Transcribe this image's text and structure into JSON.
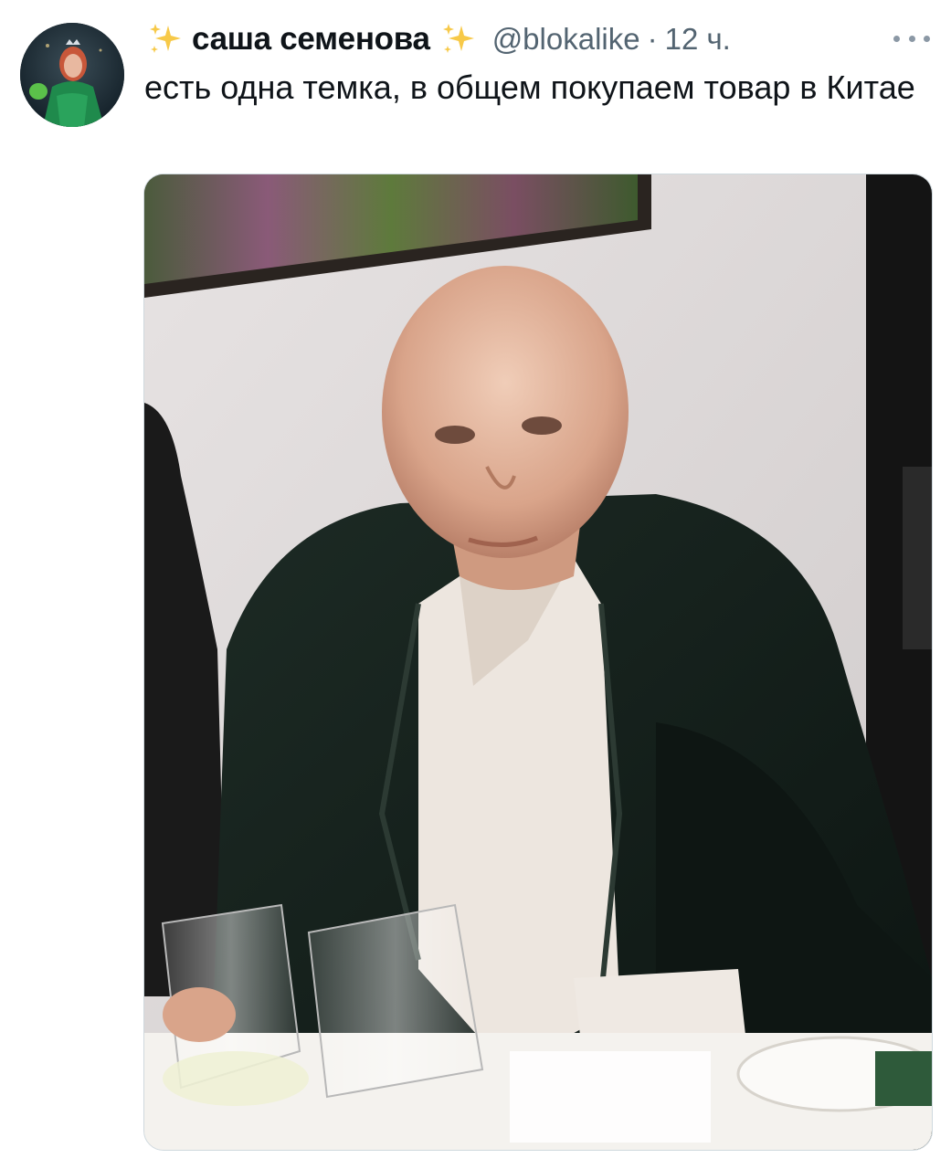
{
  "tweet": {
    "author": {
      "display_name": "саша семенова",
      "handle": "@blokalike",
      "avatar_icon": "avatar-image"
    },
    "separator": "·",
    "time": "12 ч.",
    "more_icon": "more-horizontal-icon",
    "name_decoration_icon": "sparkles-icon",
    "text": "есть одна темка, в общем покупаем товар в Китае",
    "media": {
      "type": "photo",
      "icon": "photo-image"
    }
  },
  "colors": {
    "text_primary": "#0f1419",
    "text_secondary": "#536471",
    "sparkle": "#f7c948",
    "border": "#cfd9de"
  }
}
